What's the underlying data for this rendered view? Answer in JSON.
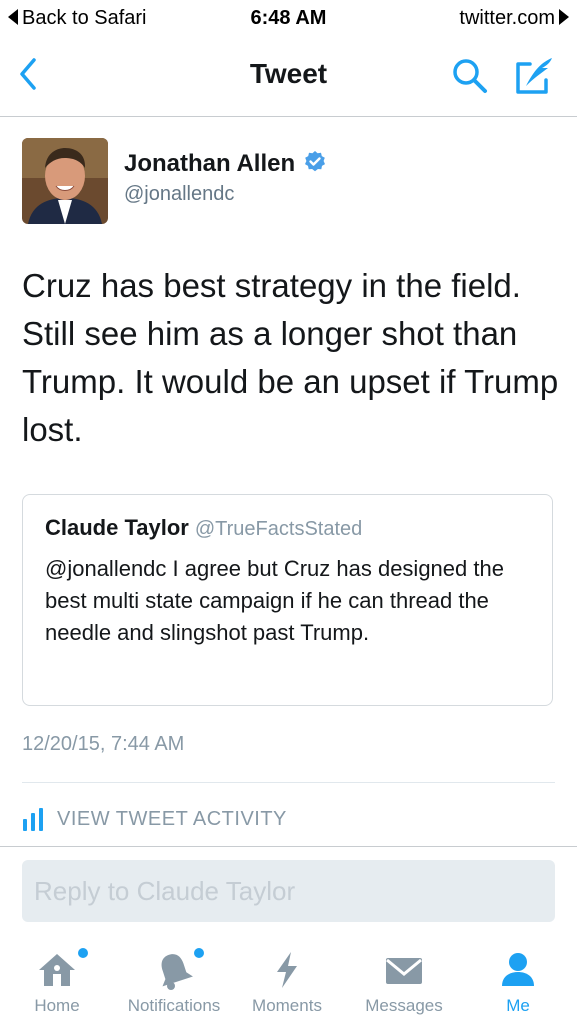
{
  "status_bar": {
    "back_app": "Back to Safari",
    "time": "6:48 AM",
    "site": "twitter.com"
  },
  "nav": {
    "title": "Tweet"
  },
  "tweet": {
    "author_name": "Jonathan Allen",
    "author_handle": "@jonallendc",
    "text": "Cruz has best strategy in the field. Still see him as a longer shot than Trump. It would be an upset if Trump lost.",
    "timestamp": "12/20/15, 7:44 AM",
    "activity_label": "VIEW TWEET ACTIVITY"
  },
  "quoted_tweet": {
    "author_name": "Claude Taylor",
    "author_handle": "@TrueFactsStated",
    "text": "@jonallendc I agree but Cruz has designed the best multi state campaign if he can thread the needle and slingshot past Trump."
  },
  "reply": {
    "placeholder": "Reply to Claude Taylor",
    "value": ""
  },
  "tabs": [
    {
      "label": "Home",
      "icon": "home-icon",
      "notification_dot": true
    },
    {
      "label": "Notifications",
      "icon": "bell-icon",
      "notification_dot": true
    },
    {
      "label": "Moments",
      "icon": "lightning-icon",
      "notification_dot": false
    },
    {
      "label": "Messages",
      "icon": "envelope-icon",
      "notification_dot": false
    },
    {
      "label": "Me",
      "icon": "person-icon",
      "notification_dot": false,
      "active": true
    }
  ],
  "colors": {
    "accent": "#1da1f2",
    "muted": "#8899a6",
    "text": "#14171a",
    "verified": "#4a9fe8"
  }
}
